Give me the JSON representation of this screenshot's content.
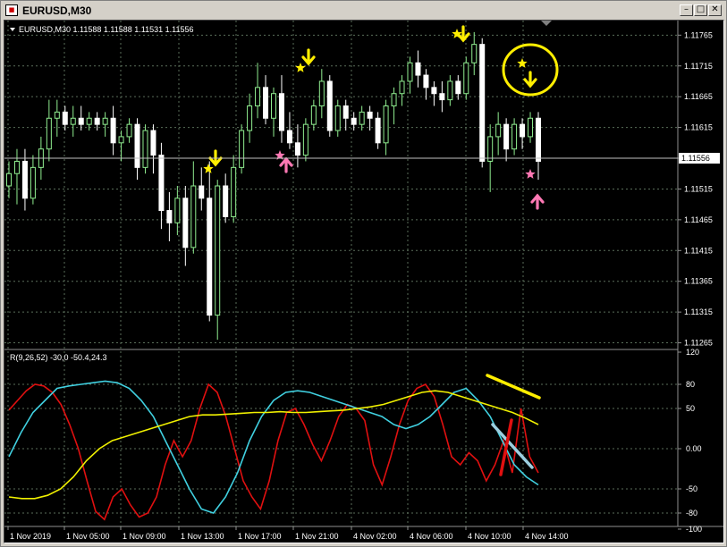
{
  "window": {
    "title": "EURUSD,M30"
  },
  "chart_header": {
    "symbol_info": "EURUSD,M30  1.11588 1.11588 1.11531 1.11556"
  },
  "price_axis": {
    "labels": [
      "1.11765",
      "1.11715",
      "1.11665",
      "1.11615",
      "1.11565",
      "1.11515",
      "1.11465",
      "1.11415",
      "1.11365",
      "1.11315",
      "1.11265"
    ],
    "current_price": "1.11556"
  },
  "indicator": {
    "label": "R(9,26,52) -30,0 -50.4,24.3",
    "axis_labels": [
      "120",
      "80",
      "50",
      "0.00",
      "-50",
      "-80",
      "-100"
    ]
  },
  "time_axis": {
    "labels": [
      "1 Nov 2019",
      "1 Nov 05:00",
      "1 Nov 09:00",
      "1 Nov 13:00",
      "1 Nov 17:00",
      "1 Nov 21:00",
      "4 Nov 02:00",
      "4 Nov 06:00",
      "4 Nov 10:00",
      "4 Nov 14:00"
    ]
  },
  "colors": {
    "background": "#000000",
    "bull_candle": "#90ee90",
    "bear_candle": "#ffffff",
    "grid": "#5a6e5a",
    "line_red": "#e01010",
    "line_cyan": "#40d0e0",
    "line_yellow": "#f0f000",
    "signal_yellow": "#ffee00",
    "signal_pink": "#ff78b4",
    "annotation_light_blue": "#9ccfe0"
  },
  "chart_data": {
    "type": "candlestick",
    "ylim": [
      1.1126,
      1.1178
    ],
    "candles": [
      [
        1.1152,
        1.1156,
        1.115,
        1.1154
      ],
      [
        1.1154,
        1.1158,
        1.1149,
        1.1156
      ],
      [
        1.1156,
        1.1158,
        1.1148,
        1.115
      ],
      [
        1.115,
        1.1157,
        1.1149,
        1.1155
      ],
      [
        1.1155,
        1.116,
        1.1153,
        1.1158
      ],
      [
        1.1158,
        1.1166,
        1.1156,
        1.1163
      ],
      [
        1.1163,
        1.1166,
        1.116,
        1.1164
      ],
      [
        1.1164,
        1.1165,
        1.1161,
        1.1162
      ],
      [
        1.1162,
        1.1165,
        1.116,
        1.1163
      ],
      [
        1.1163,
        1.1165,
        1.1161,
        1.1162
      ],
      [
        1.1162,
        1.1164,
        1.1161,
        1.1163
      ],
      [
        1.1163,
        1.1164,
        1.1161,
        1.1162
      ],
      [
        1.1162,
        1.1164,
        1.116,
        1.1163
      ],
      [
        1.1163,
        1.1165,
        1.1157,
        1.1159
      ],
      [
        1.1159,
        1.1161,
        1.1156,
        1.116
      ],
      [
        1.116,
        1.1163,
        1.1159,
        1.1162
      ],
      [
        1.1162,
        1.1163,
        1.1153,
        1.1155
      ],
      [
        1.1155,
        1.1162,
        1.1154,
        1.1161
      ],
      [
        1.1161,
        1.1162,
        1.1154,
        1.1157
      ],
      [
        1.1157,
        1.1159,
        1.1145,
        1.1148
      ],
      [
        1.1148,
        1.1151,
        1.1143,
        1.1146
      ],
      [
        1.1146,
        1.1152,
        1.1144,
        1.115
      ],
      [
        1.115,
        1.1152,
        1.1139,
        1.1142
      ],
      [
        1.1142,
        1.1156,
        1.1141,
        1.1152
      ],
      [
        1.1152,
        1.1155,
        1.1148,
        1.115
      ],
      [
        1.115,
        1.1156,
        1.113,
        1.1131
      ],
      [
        1.1131,
        1.1153,
        1.1127,
        1.1152
      ],
      [
        1.1152,
        1.1154,
        1.1146,
        1.1147
      ],
      [
        1.1147,
        1.1157,
        1.1146,
        1.1155
      ],
      [
        1.1155,
        1.1162,
        1.1154,
        1.1161
      ],
      [
        1.1161,
        1.1167,
        1.1159,
        1.1165
      ],
      [
        1.1165,
        1.1172,
        1.1163,
        1.1168
      ],
      [
        1.1168,
        1.117,
        1.1162,
        1.1163
      ],
      [
        1.1163,
        1.1168,
        1.116,
        1.1167
      ],
      [
        1.1167,
        1.117,
        1.1159,
        1.1161
      ],
      [
        1.1161,
        1.1164,
        1.1158,
        1.1159
      ],
      [
        1.1159,
        1.1162,
        1.1155,
        1.1157
      ],
      [
        1.1157,
        1.1163,
        1.1156,
        1.1162
      ],
      [
        1.1162,
        1.1166,
        1.1161,
        1.1165
      ],
      [
        1.1165,
        1.1171,
        1.1163,
        1.1169
      ],
      [
        1.1169,
        1.117,
        1.116,
        1.1161
      ],
      [
        1.1161,
        1.1166,
        1.116,
        1.1165
      ],
      [
        1.1165,
        1.1166,
        1.1161,
        1.1163
      ],
      [
        1.1163,
        1.1164,
        1.1161,
        1.1162
      ],
      [
        1.1162,
        1.1165,
        1.1161,
        1.1164
      ],
      [
        1.1164,
        1.1165,
        1.1161,
        1.1163
      ],
      [
        1.1163,
        1.1164,
        1.1158,
        1.1159
      ],
      [
        1.1159,
        1.1166,
        1.1157,
        1.1165
      ],
      [
        1.1165,
        1.1168,
        1.1162,
        1.1167
      ],
      [
        1.1167,
        1.117,
        1.1165,
        1.1169
      ],
      [
        1.1169,
        1.1173,
        1.1167,
        1.1172
      ],
      [
        1.1172,
        1.1174,
        1.1168,
        1.117
      ],
      [
        1.117,
        1.1171,
        1.1166,
        1.1168
      ],
      [
        1.1168,
        1.1169,
        1.1165,
        1.1167
      ],
      [
        1.1167,
        1.1169,
        1.1164,
        1.1166
      ],
      [
        1.1166,
        1.117,
        1.1165,
        1.1169
      ],
      [
        1.1169,
        1.117,
        1.1166,
        1.1167
      ],
      [
        1.1167,
        1.1173,
        1.1166,
        1.1172
      ],
      [
        1.1172,
        1.1177,
        1.117,
        1.1175
      ],
      [
        1.1175,
        1.1176,
        1.1155,
        1.1156
      ],
      [
        1.1156,
        1.1162,
        1.1151,
        1.116
      ],
      [
        1.116,
        1.1164,
        1.1157,
        1.1162
      ],
      [
        1.1162,
        1.1163,
        1.1156,
        1.1158
      ],
      [
        1.1158,
        1.1163,
        1.1157,
        1.1162
      ],
      [
        1.1162,
        1.1163,
        1.1158,
        1.116
      ],
      [
        1.116,
        1.1164,
        1.1159,
        1.1163
      ],
      [
        1.1163,
        1.1164,
        1.1153,
        1.1156
      ]
    ],
    "series": [
      {
        "name": "R(9)",
        "values": [
          48,
          60,
          72,
          80,
          78,
          70,
          55,
          30,
          0,
          -40,
          -78,
          -88,
          -60,
          -50,
          -70,
          -85,
          -80,
          -60,
          -20,
          10,
          -10,
          10,
          50,
          80,
          70,
          40,
          0,
          -40,
          -60,
          -75,
          -40,
          10,
          45,
          50,
          30,
          5,
          -15,
          10,
          40,
          55,
          50,
          35,
          -20,
          -45,
          -10,
          30,
          60,
          75,
          80,
          65,
          30,
          -10,
          -20,
          -5,
          -15,
          -40,
          -20,
          10,
          -30,
          50,
          -10,
          -30
        ]
      },
      {
        "name": "R(26)",
        "values": [
          -10,
          20,
          45,
          60,
          75,
          78,
          80,
          82,
          84,
          82,
          75,
          60,
          40,
          10,
          -20,
          -50,
          -75,
          -80,
          -60,
          -30,
          10,
          40,
          60,
          70,
          72,
          70,
          65,
          60,
          55,
          50,
          45,
          40,
          30,
          25,
          30,
          40,
          55,
          70,
          75,
          60,
          40,
          10,
          -20,
          -35,
          -45
        ]
      },
      {
        "name": "R(52)",
        "values": [
          -60,
          -62,
          -62,
          -58,
          -50,
          -35,
          -15,
          0,
          10,
          15,
          20,
          25,
          30,
          35,
          40,
          42,
          42,
          43,
          44,
          45,
          45,
          46,
          45,
          45,
          46,
          47,
          48,
          50,
          52,
          55,
          60,
          65,
          70,
          72,
          70,
          65,
          60,
          55,
          50,
          45,
          38,
          30
        ]
      }
    ]
  }
}
